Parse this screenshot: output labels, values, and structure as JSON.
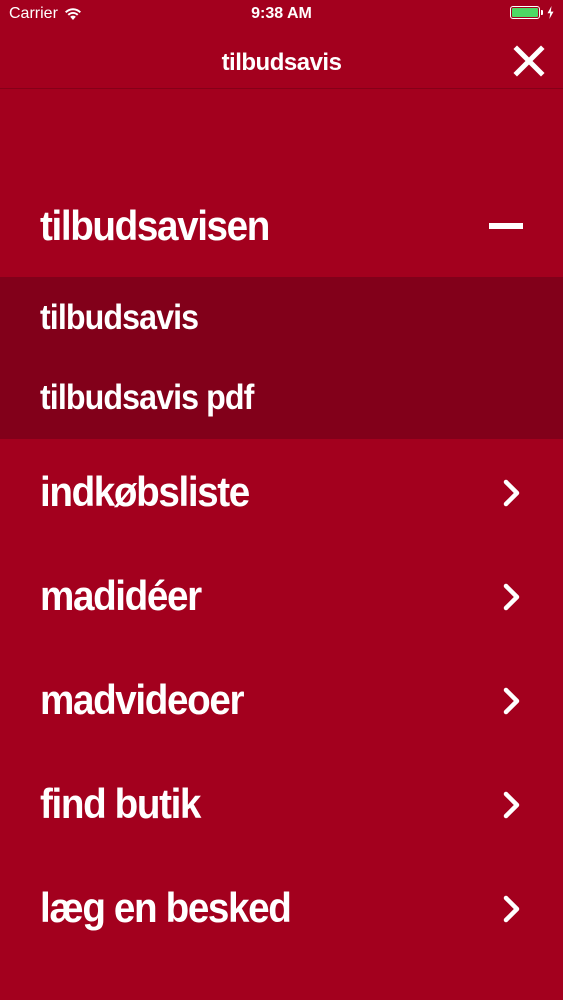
{
  "status_bar": {
    "carrier": "Carrier",
    "time": "9:38 AM",
    "battery_level": 1.0,
    "battery_color": "#4CD964"
  },
  "nav": {
    "title": "tilbudsavis",
    "close_icon": "close-icon"
  },
  "menu": {
    "expanded_section": {
      "label": "tilbudsavisen",
      "icon": "minus-icon",
      "items": [
        {
          "label": "tilbudsavis"
        },
        {
          "label": "tilbudsavis pdf"
        }
      ]
    },
    "items": [
      {
        "label": "indkøbsliste",
        "icon": "chevron-right-icon"
      },
      {
        "label": "madidéer",
        "icon": "chevron-right-icon"
      },
      {
        "label": "madvideoer",
        "icon": "chevron-right-icon"
      },
      {
        "label": "find butik",
        "icon": "chevron-right-icon"
      },
      {
        "label": "læg en besked",
        "icon": "chevron-right-icon"
      }
    ]
  },
  "colors": {
    "background": "#A3001E",
    "submenu_background": "#82001A",
    "text": "#FFFFFF"
  }
}
